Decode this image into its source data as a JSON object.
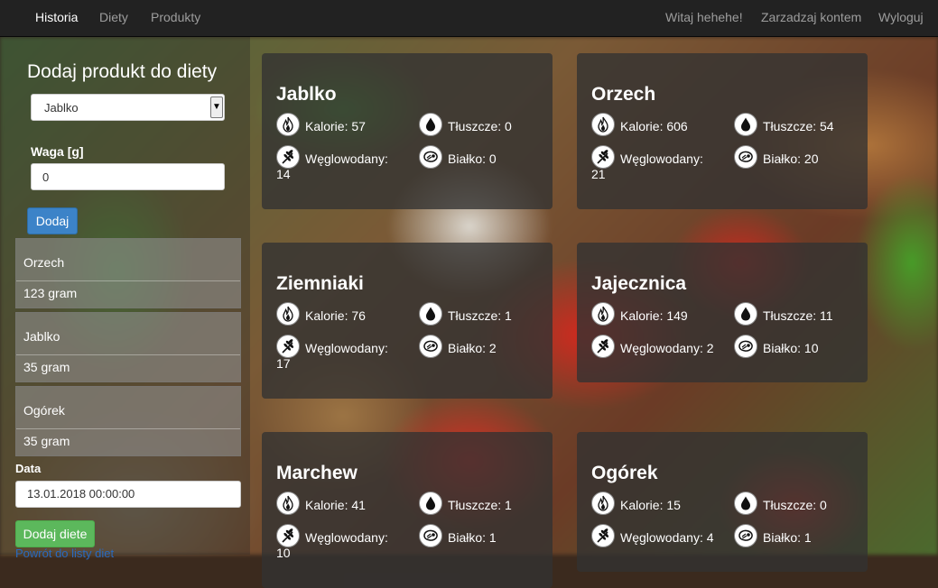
{
  "nav": {
    "left": [
      "Historia",
      "Diety",
      "Produkty"
    ],
    "right": [
      "Witaj hehehe!",
      "Zarzadzaj kontem",
      "Wyloguj"
    ]
  },
  "form": {
    "title": "Dodaj produkt do diety",
    "product_selected": "Jablko",
    "weight_label": "Waga [g]",
    "weight_value": "0",
    "add_button": "Dodaj",
    "date_label": "Data",
    "date_value": "13.01.2018 00:00:00",
    "submit_button": "Dodaj diete",
    "back_link": "Powrót do listy diet"
  },
  "entries": [
    {
      "name": "Orzech",
      "qty": "123 gram"
    },
    {
      "name": "Jablko",
      "qty": "35 gram"
    },
    {
      "name": "Ogórek",
      "qty": "35 gram"
    }
  ],
  "labels": {
    "calories": "Kalorie:",
    "fat": "Tłuszcze:",
    "carbs": "Węglowodany:",
    "protein": "Białko:"
  },
  "products": [
    {
      "name": "Jablko",
      "calories": "57",
      "fat": "0",
      "carbs": "14",
      "protein": "0"
    },
    {
      "name": "Orzech",
      "calories": "606",
      "fat": "54",
      "carbs": "21",
      "protein": "20"
    },
    {
      "name": "Ziemniaki",
      "calories": "76",
      "fat": "1",
      "carbs": "17",
      "protein": "2"
    },
    {
      "name": "Jajecznica",
      "calories": "149",
      "fat": "11",
      "carbs": "2",
      "protein": "10"
    },
    {
      "name": "Marchew",
      "calories": "41",
      "fat": "1",
      "carbs": "10",
      "protein": "1"
    },
    {
      "name": "Ogórek",
      "calories": "15",
      "fat": "0",
      "carbs": "4",
      "protein": "1"
    }
  ]
}
